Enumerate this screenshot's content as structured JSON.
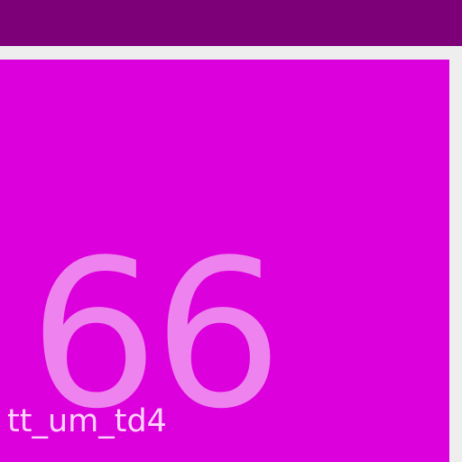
{
  "colors": {
    "app_bar": "#7e0078",
    "background": "#eeeeee",
    "tile_background": "#dc00dc",
    "number_color": "#ee82ee",
    "label_color": "#ffd2ff"
  },
  "tile": {
    "value": "66",
    "label": "tt_um_td4"
  }
}
